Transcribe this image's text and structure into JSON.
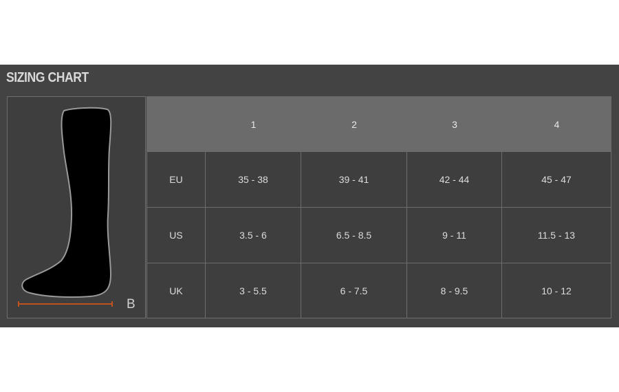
{
  "title": "SIZING CHART",
  "measure_label": "B",
  "colors": {
    "panel": "#434343",
    "header_band": "#6b6b6b",
    "measure_line": "#c0521f"
  },
  "icons": {
    "sock": "sock-silhouette-icon"
  },
  "table": {
    "header": [
      "",
      "1",
      "2",
      "3",
      "4"
    ],
    "rows": [
      {
        "label": "EU",
        "values": [
          "35 - 38",
          "39 - 41",
          "42 - 44",
          "45 - 47"
        ]
      },
      {
        "label": "US",
        "values": [
          "3.5 - 6",
          "6.5 - 8.5",
          "9 - 11",
          "11.5 - 13"
        ]
      },
      {
        "label": "UK",
        "values": [
          "3 - 5.5",
          "6 - 7.5",
          "8 - 9.5",
          "10 - 12"
        ]
      }
    ]
  }
}
